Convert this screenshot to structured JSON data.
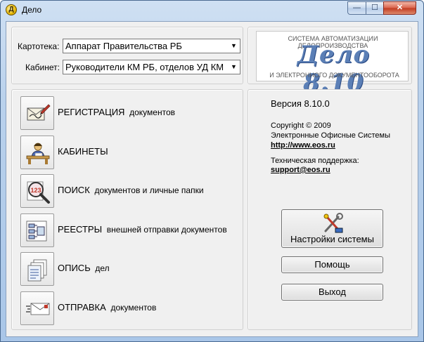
{
  "window": {
    "title": "Дело",
    "icon_name": "delo-app-icon",
    "min_glyph": "—",
    "max_glyph": "☐",
    "close_glyph": "✕"
  },
  "filters": {
    "kartoteka_label": "Картотека:",
    "kartoteka_value": "Аппарат Правительства РБ",
    "kabinet_label": "Кабинет:",
    "kabinet_value": "Руководители КМ РБ, отделов УД КМ"
  },
  "logo": {
    "top_line": "СИСТЕМА АВТОМАТИЗАЦИИ ДЕЛОПРОИЗВОДСТВА",
    "main": "Дело 8.10",
    "bottom_line": "И ЭЛЕКТРОННОГО ДОКУМЕНТООБОРОТА"
  },
  "commands": [
    {
      "caps": "РЕГИСТРАЦИЯ",
      "rest": "документов",
      "icon": "registration-icon"
    },
    {
      "caps": "КАБИНЕТЫ",
      "rest": "",
      "icon": "cabinet-icon"
    },
    {
      "caps": "ПОИСК",
      "rest": "документов и личные папки",
      "icon": "search-icon"
    },
    {
      "caps": "РЕЕСТРЫ",
      "rest": "внешней отправки документов",
      "icon": "registry-icon"
    },
    {
      "caps": "ОПИСЬ",
      "rest": "дел",
      "icon": "inventory-icon"
    },
    {
      "caps": "ОТПРАВКА",
      "rest": "документов",
      "icon": "dispatch-icon"
    }
  ],
  "info": {
    "version": "Версия 8.10.0",
    "copyright": "Copyright © 2009",
    "company": "Электронные Офисные Системы",
    "website": "http://www.eos.ru",
    "support_label": "Техническая поддержка:",
    "support_email": "support@eos.ru"
  },
  "buttons": {
    "settings": "Настройки системы",
    "settings_icon": "settings-tools-icon",
    "help": "Помощь",
    "exit": "Выход"
  }
}
